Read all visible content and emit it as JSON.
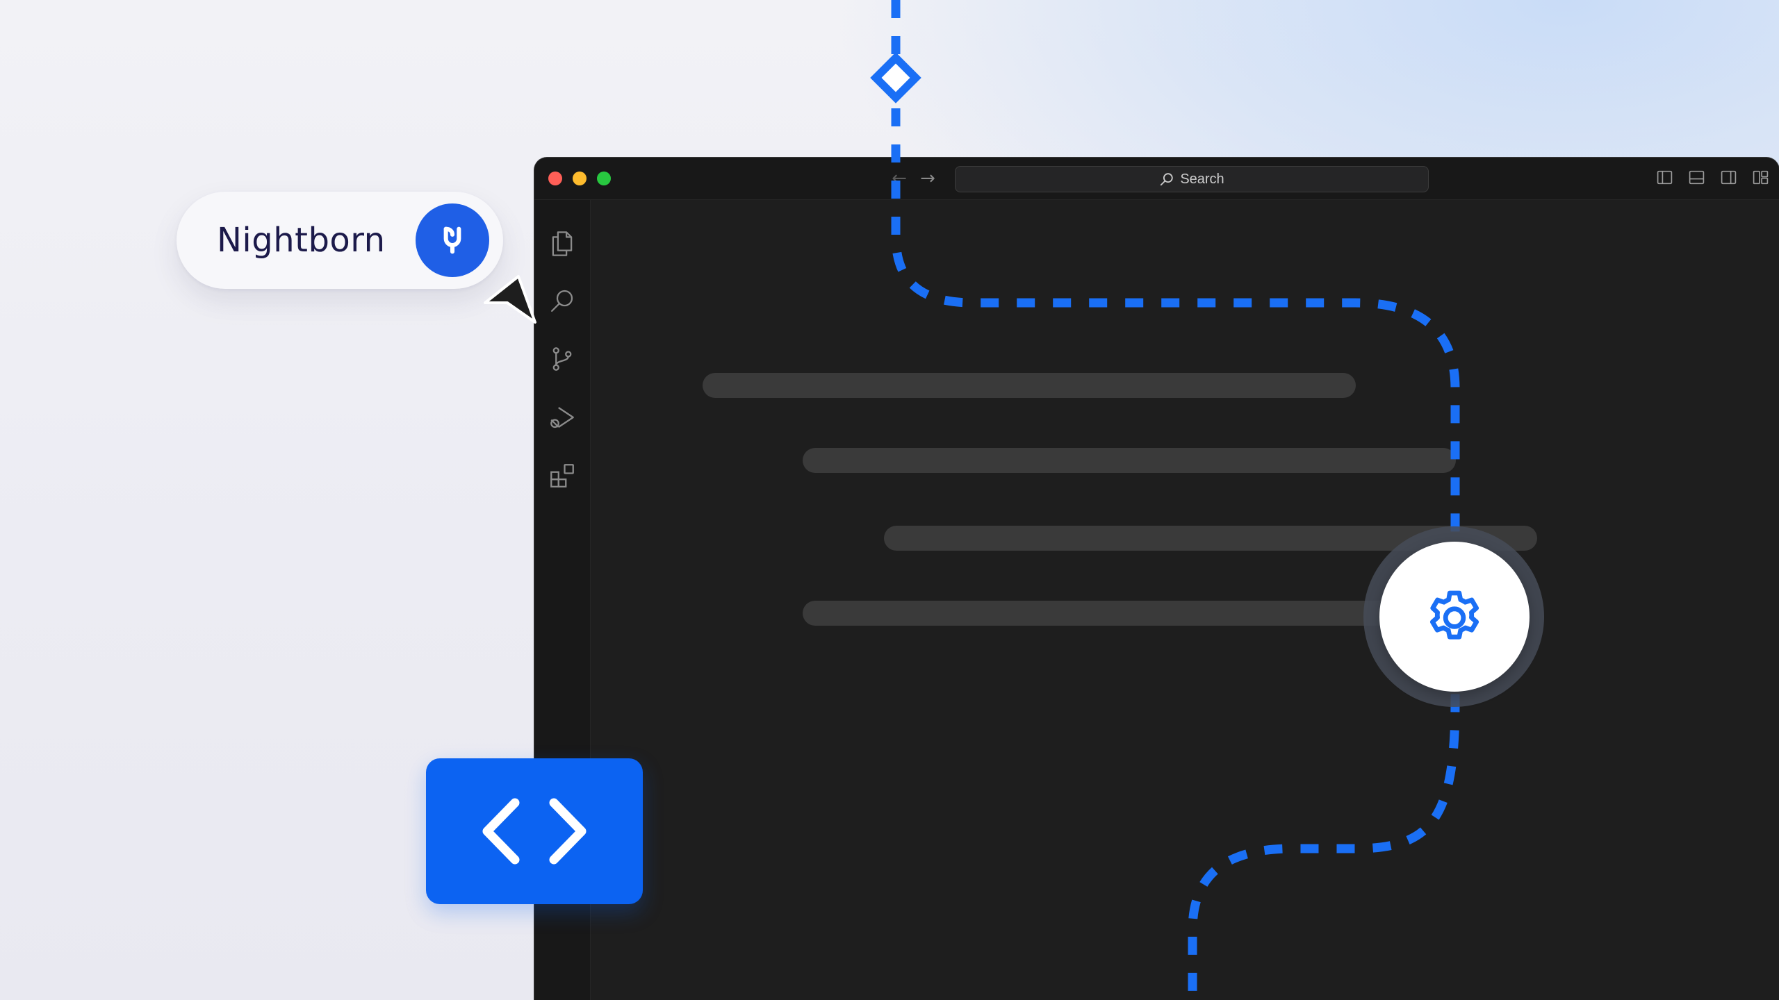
{
  "brand": {
    "name": "Nightborn",
    "logo_icon": "nightborn-logo-icon",
    "accent": "#0c63f2"
  },
  "window": {
    "traffic_lights": {
      "close": "#ff5f57",
      "minimize": "#febc2e",
      "maximize": "#28c840"
    },
    "nav": {
      "back_glyph": "←",
      "forward_glyph": "→"
    },
    "search": {
      "label": "Search",
      "icon": "search-icon"
    },
    "layout_toggles": [
      "toggle-primary-sidebar-icon",
      "toggle-panel-icon",
      "toggle-secondary-sidebar-icon",
      "customize-layout-icon"
    ],
    "activity_bar": [
      "explorer-icon",
      "search-icon",
      "source-control-icon",
      "run-and-debug-icon",
      "extensions-icon",
      "accounts-icon"
    ]
  },
  "overlays": {
    "code_button_icon": "code-brackets-icon",
    "settings_node_icon": "gear-icon",
    "flow_start_icon": "diamond-icon",
    "path_color": "#1a6ff5"
  }
}
